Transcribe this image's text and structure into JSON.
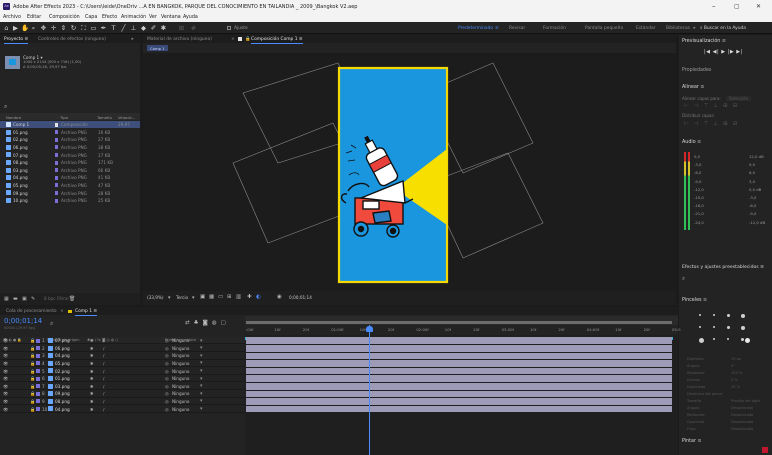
{
  "window": {
    "title": "Adobe After Effects 2023 - C:\\Users\\leide\\OneDriv ...A EN BANGKOK, PARQUE DEL CONOCIMIENTO EN TAILANDIA _ 2009_\\Bangkok V2.aep",
    "app_badge": "Ae",
    "minimize": "–",
    "maximize": "▢",
    "close": "✕"
  },
  "menu": [
    "Archivo",
    "Editar",
    "Composición",
    "Capa",
    "Efecto",
    "Animación",
    "Ver",
    "Ventana",
    "Ayuda"
  ],
  "toolbar": {
    "snap_label": "Ajuste",
    "workspaces": [
      "Predeterminado",
      "Revisar",
      "Formación",
      "Pantalla pequeña",
      "Estándar",
      "Bibliotecas"
    ],
    "active_workspace": "Predeterminado",
    "search_help": "Buscar en la Ayuda",
    "more": "»"
  },
  "project": {
    "tab_project": "Proyecto ≡",
    "tab_effects": "Controles de efectos (ninguno)",
    "comp_name": "Comp 1 ▾",
    "comp_info1": "1000 x 2144 (500 x 716) (1,00)",
    "comp_info2": "Δ 0;00;05;18, 29,97 fps",
    "search_icon": "⌕",
    "columns": [
      "Nombre",
      "Tipo",
      "Tamaño",
      "Velocid..."
    ],
    "items": [
      {
        "name": "Comp 1",
        "type": "Composición",
        "size": "",
        "fps": "29,97"
      },
      {
        "name": "01.png",
        "type": "Archivo PNG",
        "size": "16 KB",
        "fps": ""
      },
      {
        "name": "02.png",
        "type": "Archivo PNG",
        "size": "27 KB",
        "fps": ""
      },
      {
        "name": "06.png",
        "type": "Archivo PNG",
        "size": "38 KB",
        "fps": ""
      },
      {
        "name": "07.png",
        "type": "Archivo PNG",
        "size": "17 KB",
        "fps": ""
      },
      {
        "name": "08.png",
        "type": "Archivo PNG",
        "size": "171 KB",
        "fps": ""
      },
      {
        "name": "03.png",
        "type": "Archivo PNG",
        "size": "66 KB",
        "fps": ""
      },
      {
        "name": "04.png",
        "type": "Archivo PNG",
        "size": "41 KB",
        "fps": ""
      },
      {
        "name": "05.png",
        "type": "Archivo PNG",
        "size": "47 KB",
        "fps": ""
      },
      {
        "name": "09.png",
        "type": "Archivo PNG",
        "size": "28 KB",
        "fps": ""
      },
      {
        "name": "10.png",
        "type": "Archivo PNG",
        "size": "25 KB",
        "fps": ""
      }
    ],
    "bpc": "8 bpc",
    "footer_filter": "Filtrar"
  },
  "viewer": {
    "tab_footage": "Material de archivo (ninguno)",
    "tab_comp": "Composición Comp 1 ≡",
    "comp_chip": "Comp 1",
    "zoom": "(33,9%)",
    "resolution": "Tercio",
    "timecode": "0;00;01;14",
    "colors": {
      "canvas": "#1a96de",
      "border": "#f4d800",
      "beam": "#f7e000"
    }
  },
  "timeline": {
    "tab_render": "Cola de procesamiento",
    "tab_comp": "Comp 1 ≡",
    "timecode": "0;00;01;14",
    "fps_sub": "00044 (29,97 fps)",
    "search_icon": "⌕",
    "col_source": "Nombre de origen",
    "col_parent": "Primario y enlace",
    "ruler": [
      ":00f",
      "10f",
      "20f",
      "01:00f",
      "10f",
      "20f",
      "02:00f",
      "10f",
      "20f",
      "03:00f",
      "10f",
      "20f",
      "04:00f",
      "10f",
      "20f",
      "05:0"
    ],
    "layers": [
      {
        "num": "1",
        "name": "07.png",
        "parent": "Ninguno"
      },
      {
        "num": "2",
        "name": "06.png",
        "parent": "Ninguno"
      },
      {
        "num": "3",
        "name": "04.png",
        "parent": "Ninguno"
      },
      {
        "num": "4",
        "name": "05.png",
        "parent": "Ninguno"
      },
      {
        "num": "5",
        "name": "02.png",
        "parent": "Ninguno"
      },
      {
        "num": "6",
        "name": "01.png",
        "parent": "Ninguno"
      },
      {
        "num": "7",
        "name": "03.png",
        "parent": "Ninguno"
      },
      {
        "num": "8",
        "name": "09.png",
        "parent": "Ninguno"
      },
      {
        "num": "9",
        "name": "08.png",
        "parent": "Ninguno"
      },
      {
        "num": "10",
        "name": "04.png",
        "parent": "Ninguno"
      }
    ]
  },
  "right": {
    "preview": "Previsualización ≡",
    "preview_controls": "|◀  ◀|  ▶  |▶  ▶|",
    "properties": "Propiedades",
    "align": "Alinear ≡",
    "align_to_label": "Alinear capas para:",
    "align_to_value": "Selección",
    "distribute": "Distribuir capas:",
    "audio": "Audio ≡",
    "audio_left": [
      "0,0",
      "-3,0",
      "-6,0",
      "-9,0",
      "-12,0",
      "-15,0",
      "-18,0",
      "-21,0",
      "-24,0"
    ],
    "audio_right": [
      "12,0 dB",
      "9,0",
      "6,0",
      "3,0",
      "0,0 dB",
      "-3,0",
      "-6,0",
      "-9,0",
      "-12,0 dB"
    ],
    "effects": "Efectos y ajustes preestablecidos ≡",
    "brushes": "Pinceles ≡",
    "paint": "Pintar ≡",
    "brush_rows": [
      "Diámetro",
      "Ángulo",
      "Redondez",
      "Dureza",
      "Espaciado",
      "Dinámica del pincel",
      "Tamaño",
      "Ángulo",
      "Redondez",
      "Opacidad",
      "Flujo"
    ],
    "brush_values": [
      "19 px",
      "0°",
      "100 %",
      "0 %",
      "25 %",
      "",
      "Presión del lápiz",
      "Desactivado",
      "Desactivado",
      "Desactivado",
      "Desactivado"
    ]
  }
}
